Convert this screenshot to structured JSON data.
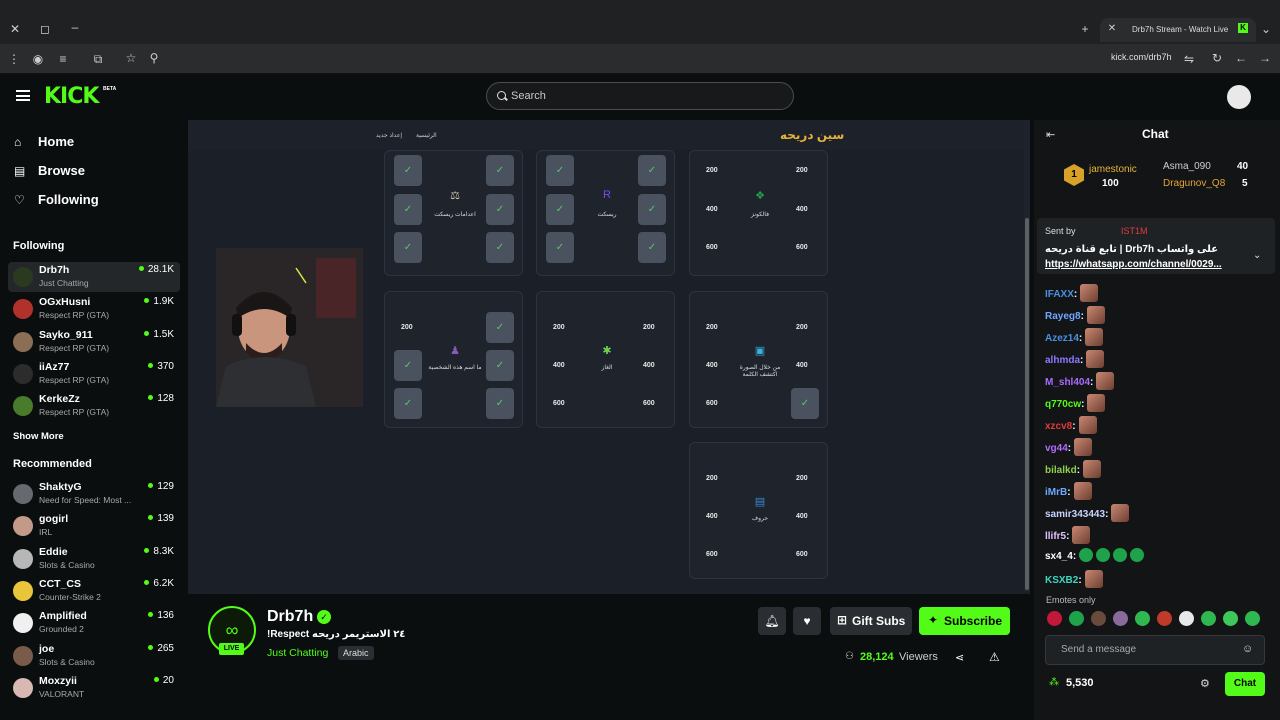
{
  "browser": {
    "tab_title": "Drb7h Stream - Watch Live",
    "url": "kick.com/drb7h"
  },
  "header": {
    "logo": "KICK",
    "logo_badge": "BETA",
    "search_placeholder": "Search"
  },
  "sidebar": {
    "nav": [
      {
        "label": "Home",
        "icon": "home-icon"
      },
      {
        "label": "Browse",
        "icon": "browse-icon"
      },
      {
        "label": "Following",
        "icon": "heart-icon"
      }
    ],
    "following_header": "Following",
    "following": [
      {
        "name": "Drb7h",
        "category": "Just Chatting",
        "viewers": "28.1K",
        "color": "#2a3a1f"
      },
      {
        "name": "OGxHusni",
        "category": "Respect RP (GTA)",
        "viewers": "1.9K",
        "color": "#b2322b"
      },
      {
        "name": "Sayko_911",
        "category": "Respect RP (GTA)",
        "viewers": "1.5K",
        "color": "#8a6f55"
      },
      {
        "name": "iiAz77",
        "category": "Respect RP (GTA)",
        "viewers": "370",
        "color": "#2c2c2c"
      },
      {
        "name": "KerkeZz",
        "category": "Respect RP (GTA)",
        "viewers": "128",
        "color": "#4a7b2a"
      }
    ],
    "show_more": "Show More",
    "recommended_header": "Recommended",
    "recommended": [
      {
        "name": "ShaktyG",
        "category": "Need for Speed: Most ...",
        "viewers": "129",
        "color": "#666a70"
      },
      {
        "name": "gogirl",
        "category": "IRL",
        "viewers": "139",
        "color": "#c39a8a"
      },
      {
        "name": "Eddie",
        "category": "Slots & Casino",
        "viewers": "8.3K",
        "color": "#b7b7b7"
      },
      {
        "name": "CCT_CS",
        "category": "Counter-Strike 2",
        "viewers": "6.2K",
        "color": "#e8c53a"
      },
      {
        "name": "Amplified",
        "category": "Grounded 2",
        "viewers": "136",
        "color": "#f0f0f0"
      },
      {
        "name": "joe",
        "category": "Slots & Casino",
        "viewers": "265",
        "color": "#7a5a48"
      },
      {
        "name": "Moxzyii",
        "category": "VALORANT",
        "viewers": "20",
        "color": "#d8b8b0"
      }
    ]
  },
  "game": {
    "title": "سين دريحه",
    "nav_home": "الرئيسية",
    "nav_new": "إعداد جديد",
    "boards": [
      {
        "label": "اعدامات ريسكت",
        "icon": "⚖",
        "pts_left": [],
        "pts_right": []
      },
      {
        "label": "ريسكت",
        "icon": "R",
        "pts_left": [],
        "pts_right": []
      },
      {
        "label": "فالكونز",
        "icon": "❖",
        "pts_left": [
          "200",
          "400",
          "600"
        ],
        "pts_right": [
          "200",
          "400",
          "600"
        ]
      },
      {
        "label": "ما اسم هذه الشخصية",
        "icon": "♟",
        "pts_left": [
          "200"
        ],
        "pts_right": []
      },
      {
        "label": "الغاز",
        "icon": "✱",
        "pts_left": [
          "200",
          "400",
          "600"
        ],
        "pts_right": [
          "200",
          "400",
          "600"
        ]
      },
      {
        "label": "من خلال الصورة اكتشف الكلمة",
        "icon": "▣",
        "pts_left": [
          "200",
          "400",
          "600"
        ],
        "pts_right": [
          "200",
          "400"
        ]
      },
      {
        "label": "حروف",
        "icon": "▤",
        "pts_left": [
          "200",
          "400",
          "600"
        ],
        "pts_right": [
          "200",
          "400",
          "600"
        ]
      }
    ]
  },
  "stream": {
    "streamer": "Drb7h",
    "live": "LIVE",
    "title": "!Respect ٢٤ الاستريمر دريحه",
    "category": "Just Chatting",
    "tag": "Arabic",
    "gift_label": "Gift Subs",
    "subscribe_label": "Subscribe",
    "viewers": "28,124",
    "viewers_label": "Viewers"
  },
  "chat": {
    "title": "Chat",
    "leaderboard": [
      {
        "rank": "1",
        "name": "jamestonic",
        "points": "100"
      },
      {
        "name": "Asma_090",
        "points": "40"
      },
      {
        "name": "Dragunov_Q8",
        "points": "5"
      }
    ],
    "pinned": {
      "sent_by": "Sent by",
      "sender": "IST1M",
      "text": "تابع قناة دريحه | Drb7h على واتساب",
      "link": "https://whatsapp.com/channel/0029..."
    },
    "messages": [
      {
        "user": "IFAXX",
        "color": "#4a90e2",
        "emotes": 1
      },
      {
        "user": "Rayeg8",
        "color": "#6fa8ff",
        "emotes": 1
      },
      {
        "user": "Azez14",
        "color": "#4a90e2",
        "emotes": 1
      },
      {
        "user": "alhmda",
        "color": "#8a7aff",
        "emotes": 1
      },
      {
        "user": "M_shl404",
        "color": "#a96bff",
        "emotes": 1
      },
      {
        "user": "q770cw",
        "color": "#53fc18",
        "emotes": 1
      },
      {
        "user": "xzcv8",
        "color": "#e03b3b",
        "emotes": 1
      },
      {
        "user": "vg44",
        "color": "#b06bff",
        "emotes": 1
      },
      {
        "user": "bilalkd",
        "color": "#8fd14f",
        "emotes": 1
      },
      {
        "user": "iMrB",
        "color": "#6fa8ff",
        "emotes": 1
      },
      {
        "user": "samir343443",
        "color": "#c9d3ff",
        "emotes": 1
      },
      {
        "user": "llifr5",
        "color": "#e0c0ff",
        "emotes": 1
      },
      {
        "user": "sx4_4",
        "color": "#ffffff",
        "emotes": 4
      },
      {
        "user": "KSXB2",
        "color": "#3fd6c0",
        "emotes": 1
      }
    ],
    "emotes_only": "Emotes only",
    "input_placeholder": "Send a message",
    "points": "5,530",
    "chat_button": "Chat"
  }
}
